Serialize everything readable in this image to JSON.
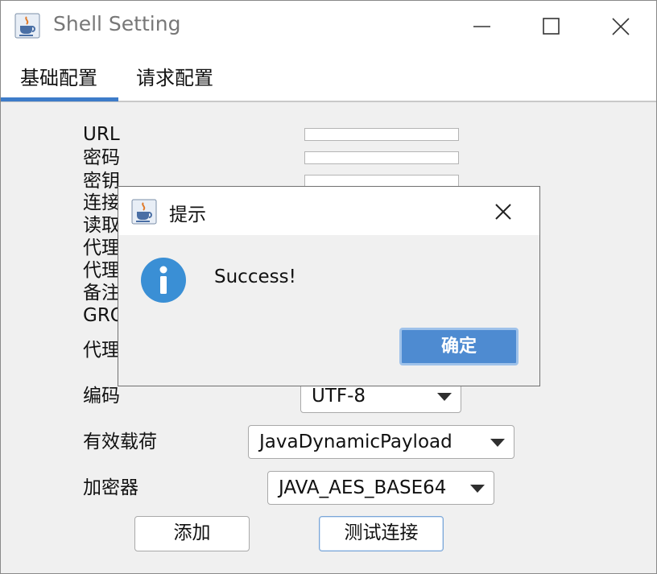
{
  "window": {
    "title": "Shell Setting",
    "app_icon": "java-coffee-cup-icon",
    "controls": {
      "minimize": "minimize-icon",
      "maximize": "maximize-icon",
      "close": "close-icon"
    }
  },
  "tabs": [
    {
      "label": "基础配置",
      "selected": true
    },
    {
      "label": "请求配置",
      "selected": false
    }
  ],
  "form": {
    "url_label": "URL",
    "password_label": "密码",
    "key_label": "密钥",
    "connect_timeout_label": "连接",
    "read_timeout_label": "读取",
    "proxy_host_label": "代理",
    "proxy_port_label": "代理",
    "remark_label": "备注",
    "group_label": "GRO",
    "proxy_type_label": "代理",
    "encoding_label": "编码",
    "encoding_value": "UTF-8",
    "payload_label": "有效载荷",
    "payload_value": "JavaDynamicPayload",
    "cryption_label": "加密器",
    "cryption_value": "JAVA_AES_BASE64"
  },
  "buttons": {
    "add": "添加",
    "test": "测试连接"
  },
  "dialog": {
    "title": "提示",
    "icon": "info-icon",
    "message": "Success!",
    "ok_label": "确定"
  },
  "colors": {
    "accent": "#3d7cc9",
    "ok_button": "#4e8bd1",
    "info_icon": "#3a8fd5"
  }
}
